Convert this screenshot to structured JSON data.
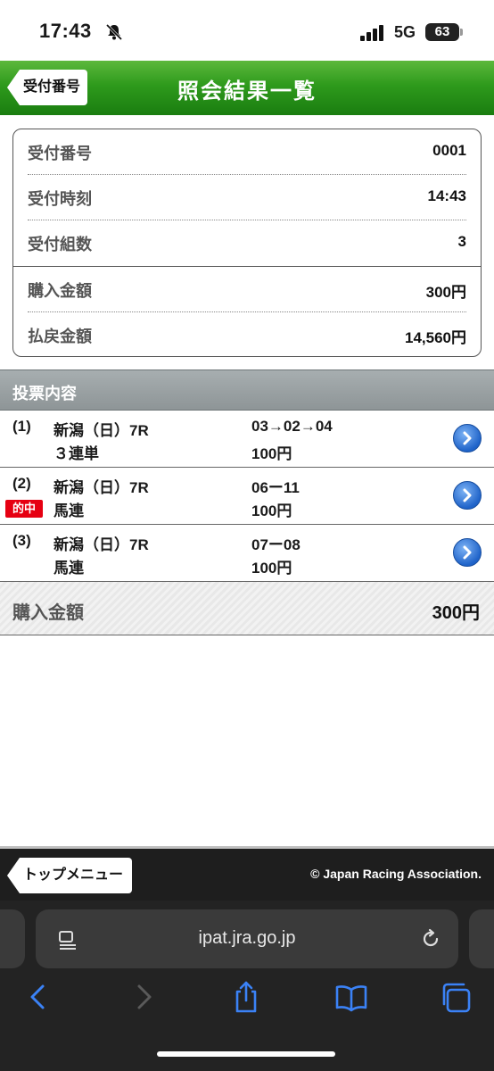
{
  "status": {
    "time": "17:43",
    "network": "5G",
    "battery": "63"
  },
  "header": {
    "back_label": "受付番号",
    "title": "照会結果一覧"
  },
  "summary": [
    {
      "label": "受付番号",
      "value": "0001"
    },
    {
      "label": "受付時刻",
      "value": "14:43"
    },
    {
      "label": "受付組数",
      "value": "3"
    },
    {
      "label": "購入金額",
      "value": "300円"
    },
    {
      "label": "払戻金額",
      "value": "14,560円"
    }
  ],
  "section_title": "投票内容",
  "bets": [
    {
      "num": "(1)",
      "race": "新潟（日）7R",
      "type": "３連単",
      "combo": "03→02→04",
      "amount": "100円",
      "hit": ""
    },
    {
      "num": "(2)",
      "race": "新潟（日）7R",
      "type": "馬連",
      "combo": "06ー11",
      "amount": "100円",
      "hit": "的中"
    },
    {
      "num": "(3)",
      "race": "新潟（日）7R",
      "type": "馬連",
      "combo": "07ー08",
      "amount": "100円",
      "hit": ""
    }
  ],
  "total": {
    "label": "購入金額",
    "value": "300円"
  },
  "footer": {
    "top_menu_label": "トップメニュー",
    "copyright": "© Japan Racing Association."
  },
  "browser": {
    "url": "ipat.jra.go.jp"
  },
  "colors": {
    "header_green": "#2e9a1c",
    "hit_red": "#e60012",
    "link_blue": "#1f63c9",
    "ios_blue": "#3b82f6"
  }
}
